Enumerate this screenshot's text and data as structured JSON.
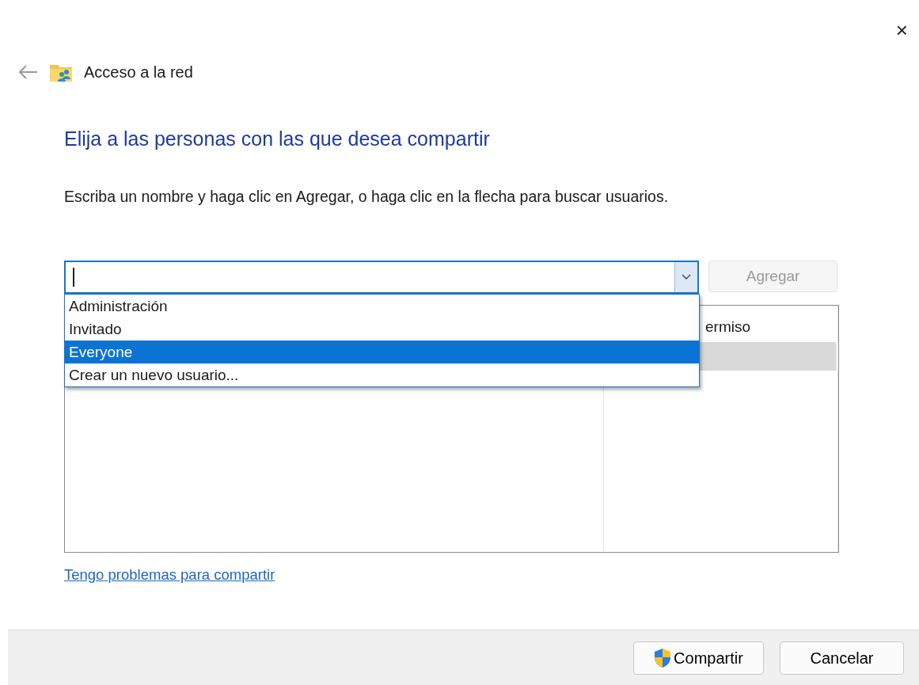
{
  "window": {
    "close": "×",
    "title": "Acceso a la red"
  },
  "heading": "Elija a las personas con las que desea compartir",
  "instruction": "Escriba un nombre y haga clic en Agregar, o haga clic en la flecha para buscar usuarios.",
  "name_field": {
    "expanded": true
  },
  "add_button": {
    "label": "Agregar",
    "disabled": true
  },
  "dropdown_items": [
    {
      "label": "Administración",
      "selected": false
    },
    {
      "label": "Invitado",
      "selected": false
    },
    {
      "label": "Everyone",
      "selected": true
    },
    {
      "label": "Crear un nuevo usuario...",
      "selected": false
    }
  ],
  "table": {
    "column_2_header": "ermiso",
    "rows": [
      {
        "selected": true
      }
    ]
  },
  "help_link": "Tengo problemas para compartir",
  "buttons": [
    {
      "kind": "shield",
      "label": "Compartir"
    },
    {
      "kind": "plain",
      "label": "Cancelar"
    }
  ]
}
